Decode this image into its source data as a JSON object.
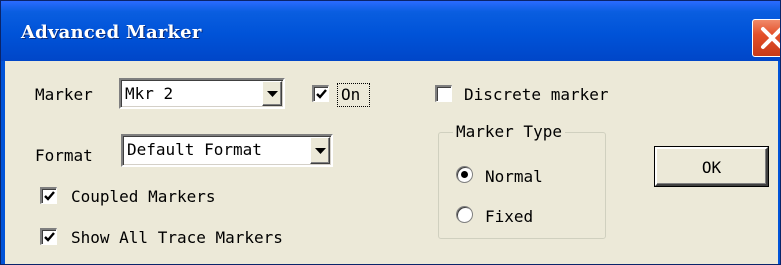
{
  "window": {
    "title": "Advanced Marker",
    "close_label": "close-icon"
  },
  "marker": {
    "label": "Marker",
    "selected": "Mkr 2",
    "on_label": "On",
    "on_checked": true
  },
  "discrete": {
    "label": "Discrete marker",
    "checked": false
  },
  "format": {
    "label": "Format",
    "selected": "Default Format"
  },
  "coupled": {
    "label": "Coupled Markers",
    "checked": true
  },
  "show_all": {
    "label": "Show All Trace Markers",
    "checked": true
  },
  "marker_type": {
    "title": "Marker Type",
    "options": [
      {
        "label": "Normal",
        "selected": true
      },
      {
        "label": "Fixed",
        "selected": false
      }
    ]
  },
  "buttons": {
    "ok": "OK"
  },
  "colors": {
    "titlebar": "#0053d8",
    "dialog_face": "#ece9d8",
    "close_button": "#e4502a"
  }
}
